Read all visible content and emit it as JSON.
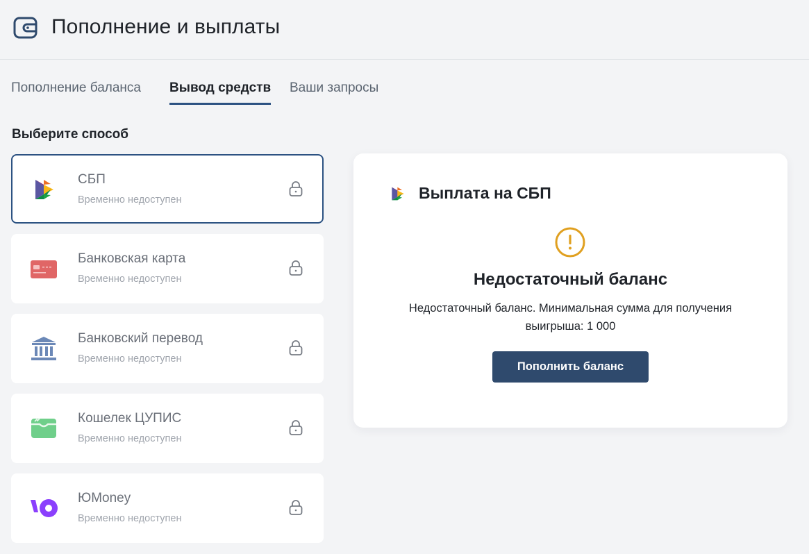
{
  "header": {
    "title": "Пополнение и выплаты",
    "icon": "wallet-icon"
  },
  "tabs": [
    {
      "label": "Пополнение баланса",
      "active": false
    },
    {
      "label": "Вывод средств",
      "active": true
    },
    {
      "label": "Ваши запросы",
      "active": false
    }
  ],
  "section": {
    "label": "Выберите способ"
  },
  "methods": [
    {
      "name": "СБП",
      "status": "Временно недоступен",
      "icon": "sbp-logo-icon",
      "selected": true
    },
    {
      "name": "Банковская карта",
      "status": "Временно недоступен",
      "icon": "bank-card-icon",
      "selected": false
    },
    {
      "name": "Банковский перевод",
      "status": "Временно недоступен",
      "icon": "bank-building-icon",
      "selected": false
    },
    {
      "name": "Кошелек ЦУПИС",
      "status": "Временно недоступен",
      "icon": "cupis-wallet-icon",
      "selected": false
    },
    {
      "name": "ЮMoney",
      "status": "Временно недоступен",
      "icon": "yumoney-logo-icon",
      "selected": false
    }
  ],
  "panel": {
    "title": "Выплата на СБП",
    "warning_title": "Недостаточный баланс",
    "warning_text": "Недостаточный баланс. Минимальная сумма для получения выигрыша: 1 000",
    "button_label": "Пополнить баланс"
  },
  "colors": {
    "accent": "#2c5282",
    "button": "#2f4a6d",
    "warning": "#e0a020",
    "background": "#f3f4f6"
  }
}
